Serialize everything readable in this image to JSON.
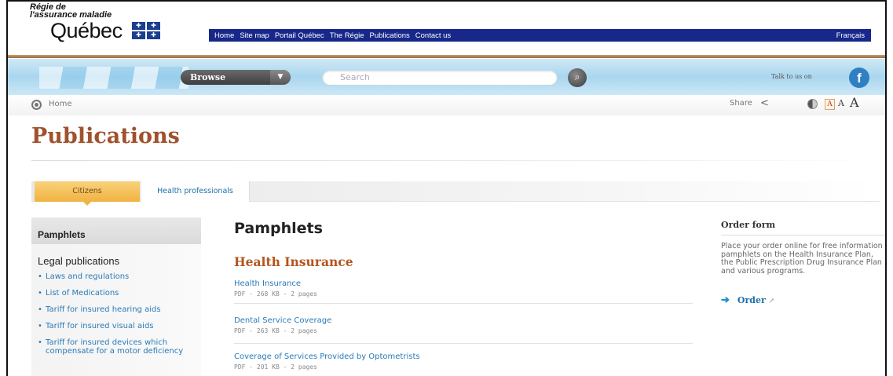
{
  "header": {
    "logo_line1": "Régie de",
    "logo_line2": "l'assurance maladie",
    "logo_quebec": "Québec",
    "nav": [
      "Home",
      "Site map",
      "Portail Québec",
      "The Régie",
      "Publications",
      "Contact us"
    ],
    "lang": "Français"
  },
  "toolbar": {
    "browse_label": "Browse",
    "search_placeholder": "Search",
    "talk_label": "Talk to us on",
    "facebook_glyph": "f"
  },
  "breadcrumb": {
    "home": "Home",
    "share": "Share",
    "font_small": "A",
    "font_medium": "A",
    "font_large": "A"
  },
  "page": {
    "title": "Publications"
  },
  "tabs": {
    "citizens": "Citizens",
    "health_professionals": "Health professionals"
  },
  "sidebar": {
    "heading": "Pamphlets",
    "subheading": "Legal publications",
    "items": [
      "Laws and regulations",
      "List of Medications",
      "Tariff for insured hearing aids",
      "Tariff for insured visual aids",
      "Tariff for insured devices which compensate for a motor deficiency"
    ]
  },
  "main": {
    "heading": "Pamphlets",
    "section": "Health Insurance",
    "publications": [
      {
        "title": "Health Insurance",
        "meta": "PDF - 268 KB - 2 pages"
      },
      {
        "title": "Dental Service Coverage",
        "meta": "PDF - 263 KB - 2 pages"
      },
      {
        "title": "Coverage of Services Provided by Optometrists",
        "meta": "PDF - 201 KB - 2 pages"
      }
    ]
  },
  "order": {
    "heading": "Order form",
    "text": "Place your order online for free information pamphlets on the Health Insurance Plan, the Public Prescription Drug Insurance Plan and various programs.",
    "link": "Order"
  },
  "colors": {
    "nav_bar": "#17288a",
    "title_brown": "#a0522d",
    "section_orange": "#b5541c",
    "link_blue": "#2a7ab8",
    "tab_active": "#f1b240"
  }
}
